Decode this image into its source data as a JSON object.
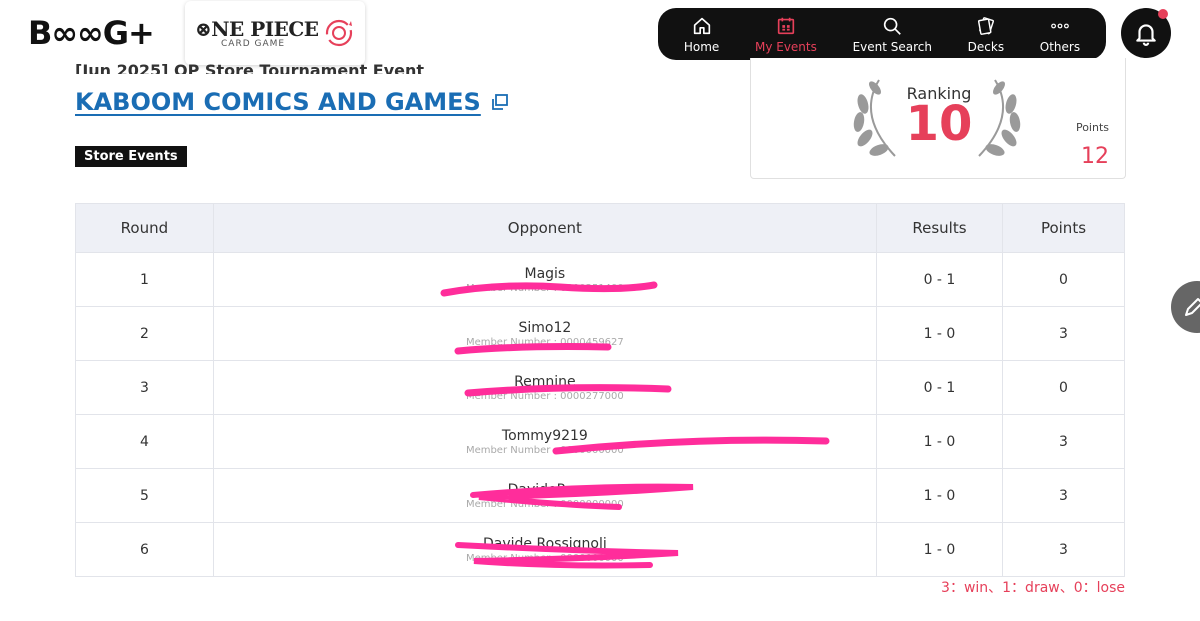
{
  "header": {
    "brand": "B∞∞G+",
    "game_title": "⊗NE PIECE",
    "game_subtitle": "CARD GAME",
    "nav": [
      {
        "label": "Home",
        "icon": "home-icon",
        "active": false
      },
      {
        "label": "My Events",
        "icon": "calendar-icon",
        "active": true
      },
      {
        "label": "Event Search",
        "icon": "search-icon",
        "active": false
      },
      {
        "label": "Decks",
        "icon": "cards-icon",
        "active": false
      },
      {
        "label": "Others",
        "icon": "more-icon",
        "active": false
      }
    ]
  },
  "event": {
    "date_title": "[Jun 2025] OP Store Tournament Event",
    "store_name": "KABOOM COMICS AND GAMES",
    "badge": "Store Events"
  },
  "ranking": {
    "label": "Ranking",
    "value": "10",
    "points_label": "Points",
    "points_value": "12"
  },
  "table": {
    "headers": [
      "Round",
      "Opponent",
      "Results",
      "Points"
    ],
    "rows": [
      {
        "round": "1",
        "opponent": "Magis",
        "member": "Member Number : 0000251400",
        "result": "0 - 1",
        "points": "0"
      },
      {
        "round": "2",
        "opponent": "Simo12",
        "member": "Member Number : 0000459627",
        "result": "1 - 0",
        "points": "3"
      },
      {
        "round": "3",
        "opponent": "Remnine",
        "member": "Member Number : 0000277000",
        "result": "0 - 1",
        "points": "0"
      },
      {
        "round": "4",
        "opponent": "Tommy9219",
        "member": "Member Number : 0000000000",
        "result": "1 - 0",
        "points": "3"
      },
      {
        "round": "5",
        "opponent": "DavideRox",
        "member": "Member Number : 0000000000",
        "result": "1 - 0",
        "points": "3"
      },
      {
        "round": "6",
        "opponent": "Davide Rossignoli",
        "member": "Member Number : 0000000000",
        "result": "1 - 0",
        "points": "3"
      }
    ]
  },
  "legend": "3：win、1：draw、0：lose",
  "colors": {
    "accent": "#e6405a",
    "link": "#1a6db4",
    "nav_bg": "#111111",
    "scribble": "#ff2d9b"
  }
}
